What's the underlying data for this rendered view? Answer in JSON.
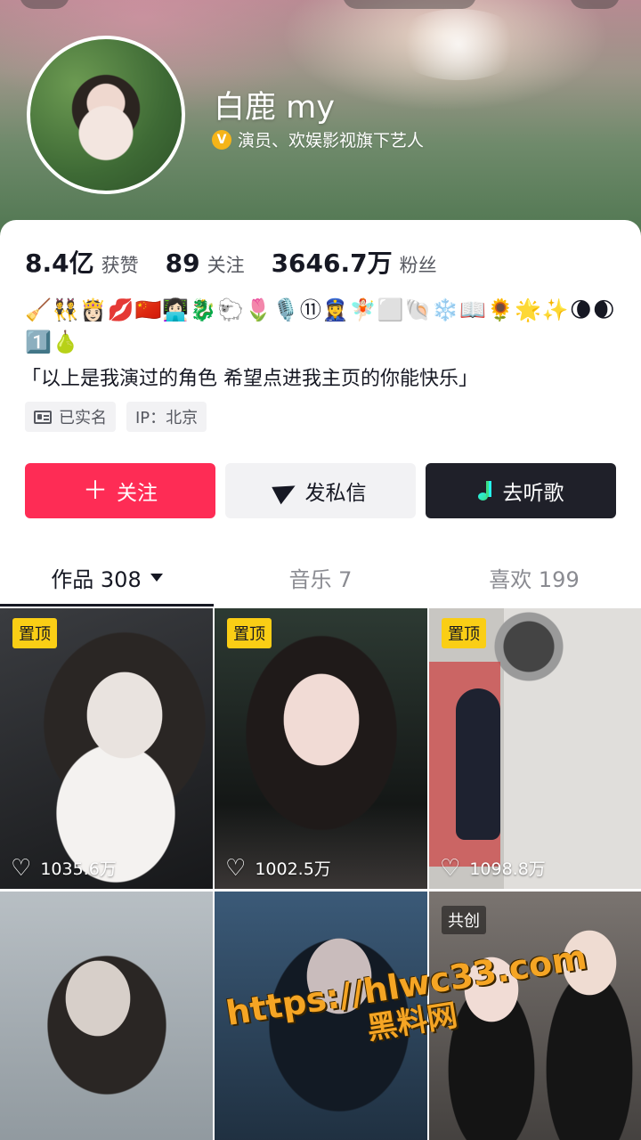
{
  "profile": {
    "name": "白鹿 my",
    "verify_text": "演员、欢娱影视旗下艺人",
    "verify_badge": "V"
  },
  "stats": [
    {
      "num": "8.4亿",
      "label": "获赞"
    },
    {
      "num": "89",
      "label": "关注"
    },
    {
      "num": "3646.7万",
      "label": "粉丝"
    }
  ],
  "bio": {
    "emojis": "🧹👯👸🏻💋🇨🇳👩🏻‍💻🐉🐑🌷🎙️⑪👮‍♀️🧚🏻⬜🐚❄️📖🌻🌟✨🌘🌒1️⃣🍐",
    "text": "「以上是我演过的角色 希望点进我主页的你能快乐」"
  },
  "tags": [
    {
      "label": "已实名"
    },
    {
      "label": "IP：北京"
    }
  ],
  "actions": {
    "follow": "关注",
    "message": "发私信",
    "music": "去听歌"
  },
  "tabs": [
    {
      "label": "作品 308"
    },
    {
      "label": "音乐 7"
    },
    {
      "label": "喜欢 199"
    }
  ],
  "videos": [
    {
      "badge": "置顶",
      "likes": "1035.6万"
    },
    {
      "badge": "置顶",
      "likes": "1002.5万"
    },
    {
      "badge": "置顶",
      "likes": "1098.8万"
    },
    {
      "badge": "",
      "likes": ""
    },
    {
      "badge": "",
      "likes": ""
    },
    {
      "badge": "共创",
      "likes": ""
    }
  ],
  "watermark": {
    "url": "https://hlwc33.com",
    "name": "黑料网"
  },
  "colors": {
    "follow": "#fe2c55",
    "music_button": "#1f2029",
    "pin_badge": "#face15",
    "verify": "#f5b418"
  }
}
